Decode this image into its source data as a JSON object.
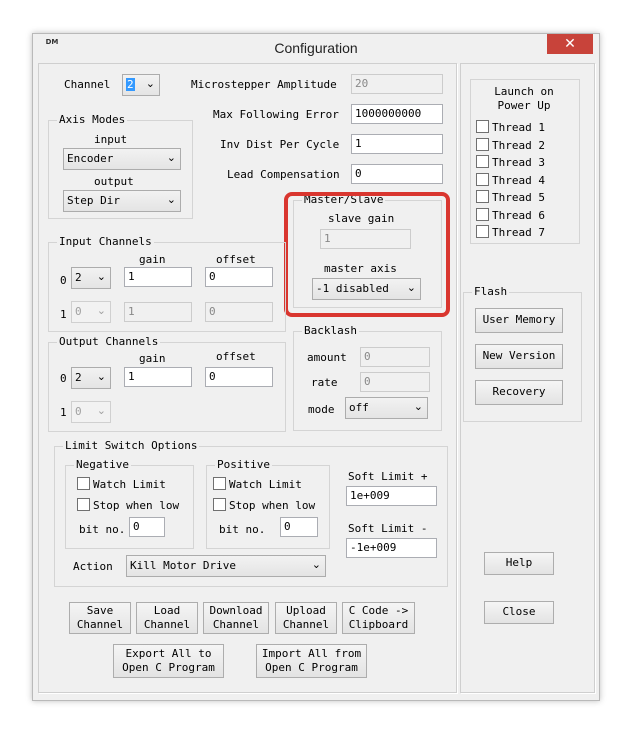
{
  "window": {
    "title": "Configuration",
    "close_glyph": "✕",
    "icon": "app-logo-icon",
    "icon_text": "DM"
  },
  "motor": {
    "channel_label": "Channel",
    "channel_value": "2",
    "microstepper_label": "Microstepper Amplitude",
    "microstepper_value": "20",
    "max_following_label": "Max Following Error",
    "max_following_value": "1000000000",
    "inv_dist_label": "Inv Dist Per Cycle",
    "inv_dist_value": "1",
    "lead_comp_label": "Lead Compensation",
    "lead_comp_value": "0"
  },
  "axis_modes": {
    "title": "Axis Modes",
    "input_label": "input",
    "input_value": "Encoder",
    "output_label": "output",
    "output_value": "Step Dir"
  },
  "master_slave": {
    "title": "Master/Slave",
    "slave_gain_label": "slave gain",
    "slave_gain_value": "1",
    "master_axis_label": "master axis",
    "master_axis_value": "-1 disabled"
  },
  "input_channels": {
    "title": "Input Channels",
    "gain_label": "gain",
    "offset_label": "offset",
    "rows": [
      {
        "index": "0",
        "channel": "2",
        "gain": "1",
        "offset": "0"
      },
      {
        "index": "1",
        "channel": "0",
        "gain": "1",
        "offset": "0"
      }
    ]
  },
  "output_channels": {
    "title": "Output Channels",
    "gain_label": "gain",
    "offset_label": "offset",
    "rows": [
      {
        "index": "0",
        "channel": "2",
        "gain": "1",
        "offset": "0"
      },
      {
        "index": "1",
        "channel": "0"
      }
    ]
  },
  "backlash": {
    "title": "Backlash",
    "amount_label": "amount",
    "amount_value": "0",
    "rate_label": "rate",
    "rate_value": "0",
    "mode_label": "mode",
    "mode_value": "off"
  },
  "limit_switch": {
    "title": "Limit Switch Options",
    "negative": {
      "title": "Negative",
      "watch_label": "Watch Limit",
      "stop_label": "Stop when low",
      "bit_label": "bit no.",
      "bit_value": "0"
    },
    "positive": {
      "title": "Positive",
      "watch_label": "Watch Limit",
      "stop_label": "Stop when low",
      "bit_label": "bit no.",
      "bit_value": "0"
    },
    "soft_plus_label": "Soft Limit +",
    "soft_plus_value": "1e+009",
    "soft_minus_label": "Soft Limit -",
    "soft_minus_value": "-1e+009",
    "action_label": "Action",
    "action_value": "Kill Motor Drive"
  },
  "buttons": {
    "save_channel": "Save\nChannel",
    "load_channel": "Load\nChannel",
    "download_channel": "Download\nChannel",
    "upload_channel": "Upload\nChannel",
    "c_code_clipboard": "C Code ->\nClipboard",
    "export_all": "Export All to\nOpen C Program",
    "import_all": "Import All from\nOpen C Program"
  },
  "threads": {
    "title": "Launch on\nPower Up",
    "items": [
      "Thread 1",
      "Thread 2",
      "Thread 3",
      "Thread 4",
      "Thread 5",
      "Thread 6",
      "Thread 7"
    ]
  },
  "flash": {
    "title": "Flash",
    "user_memory": "User Memory",
    "new_version": "New Version",
    "recovery": "Recovery"
  },
  "side_buttons": {
    "help": "Help",
    "close": "Close"
  },
  "colors": {
    "highlight": "#d9362f",
    "close_button": "#c8433a"
  }
}
